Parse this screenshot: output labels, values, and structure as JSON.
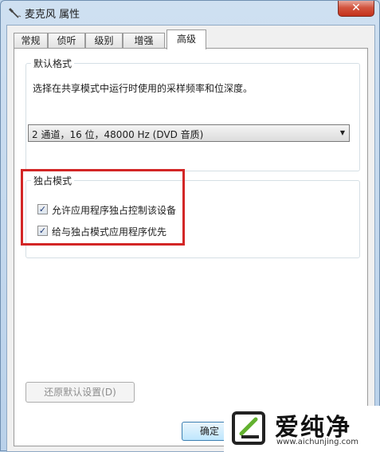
{
  "window": {
    "title": "麦克风 属性",
    "close_glyph": "✕",
    "icon": "microphone-icon"
  },
  "tabs": [
    {
      "label": "常规",
      "active": false
    },
    {
      "label": "侦听",
      "active": false
    },
    {
      "label": "级别",
      "active": false
    },
    {
      "label": "增强",
      "active": false
    },
    {
      "label": "高级",
      "active": true
    }
  ],
  "default_format": {
    "group_label": "默认格式",
    "description": "选择在共享模式中运行时使用的采样频率和位深度。",
    "selected_value": "2 通道，16 位，48000 Hz (DVD 音质)",
    "arrow_glyph": "▼"
  },
  "exclusive_mode": {
    "group_label": "独占模式",
    "options": [
      {
        "label": "允许应用程序独占控制该设备",
        "checked": true
      },
      {
        "label": "给与独占模式应用程序优先",
        "checked": true
      }
    ],
    "check_glyph": "✓",
    "highlight_color": "#d32626"
  },
  "buttons": {
    "restore_defaults": "还原默认设置(D)",
    "ok": "确定"
  },
  "watermark": {
    "text": "爱纯净",
    "url": "www.aichunjing.com",
    "logo": "brand-logo-icon"
  }
}
